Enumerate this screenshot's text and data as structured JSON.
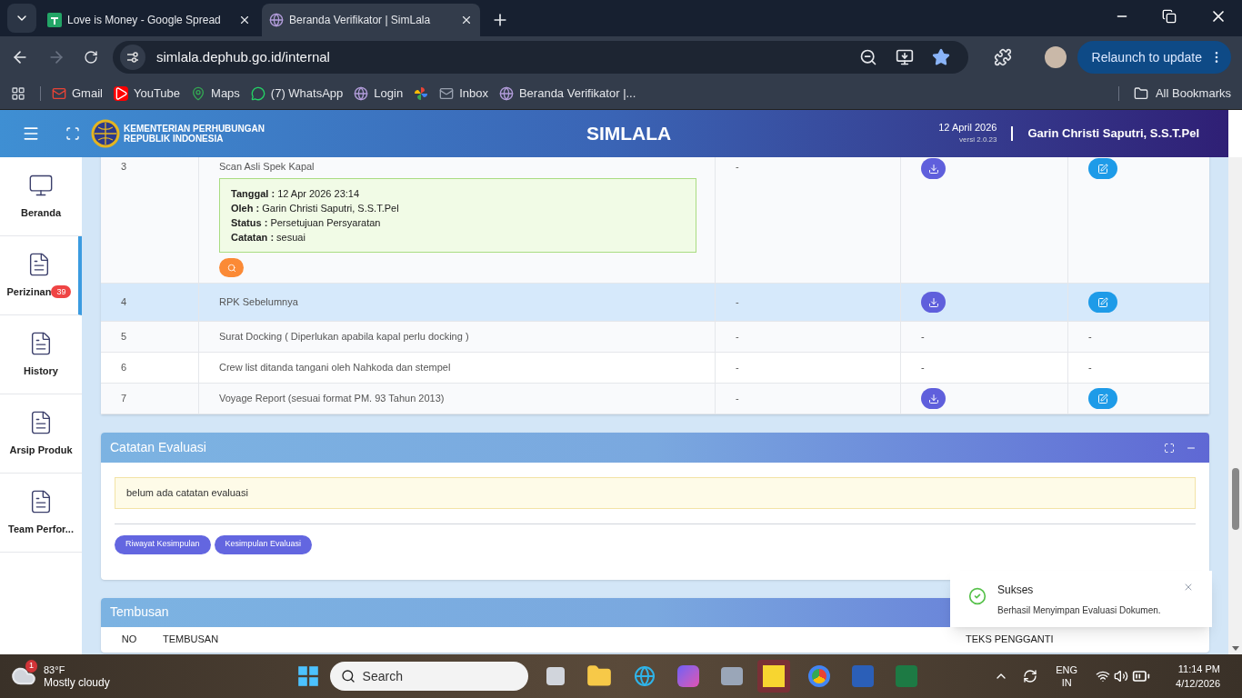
{
  "browser": {
    "tabs": [
      {
        "title": "Love is Money - Google Spread",
        "selected": false
      },
      {
        "title": "Beranda Verifikator | SimLala",
        "selected": true
      }
    ],
    "address": "simlala.dephub.go.id/internal",
    "relaunch_button": "Relaunch to update",
    "bookmarks": [
      "Gmail",
      "YouTube",
      "Maps",
      "(7) WhatsApp",
      "Login",
      "Inbox",
      "Beranda Verifikator |..."
    ],
    "all_bookmarks": "All Bookmarks"
  },
  "header": {
    "org_lines": [
      "KEMENTERIAN PERHUBUNGAN",
      "REPUBLIK INDONESIA"
    ],
    "title": "SIMLALA",
    "date": "12 April 2026",
    "version": "versi 2.0.23",
    "user": "Garin Christi Saputri, S.S.T.Pel"
  },
  "sidebar": {
    "items": [
      {
        "label": "Beranda",
        "selected": false
      },
      {
        "label": "Perizinan",
        "selected": true,
        "badge": "39"
      },
      {
        "label": "History",
        "selected": false
      },
      {
        "label": "Arsip Produk",
        "selected": false
      },
      {
        "label": "Team Perfor...",
        "selected": false
      }
    ]
  },
  "documents": {
    "rows": [
      {
        "no": "3",
        "name": "Scan Asli Spek Kapal",
        "highlighted": false,
        "note": [
          {
            "label": "Tanggal :",
            "value": "12 Apr 2026 23:14"
          },
          {
            "label": "Oleh :",
            "value": "Garin Christi Saputri, S.S.T.Pel"
          },
          {
            "label": "Status :",
            "value": "Persetujuan Persyaratan"
          },
          {
            "label": "Catatan :",
            "value": "sesuai"
          }
        ],
        "column_3": "-",
        "actions": [
          {
            "kind": "download"
          },
          {
            "kind": "edit"
          }
        ]
      },
      {
        "no": "4",
        "name": "RPK Sebelumnya",
        "highlighted": true,
        "column_3": "-",
        "actions": [
          {
            "kind": "download"
          },
          {
            "kind": "edit"
          }
        ]
      },
      {
        "no": "5",
        "name": "Surat Docking ( Diperlukan apabila kapal perlu docking )",
        "highlighted": false,
        "column_3": "-",
        "actions": [
          {
            "kind": "text",
            "text": "-"
          },
          {
            "kind": "text",
            "text": "-"
          }
        ]
      },
      {
        "no": "6",
        "name": "Crew list ditanda tangani oleh Nahkoda dan stempel",
        "highlighted": false,
        "column_3": "-",
        "actions": [
          {
            "kind": "text",
            "text": "-"
          },
          {
            "kind": "text",
            "text": "-"
          }
        ]
      },
      {
        "no": "7",
        "name": "Voyage Report (sesuai format PM. 93 Tahun 2013)",
        "highlighted": false,
        "column_3": "-",
        "actions": [
          {
            "kind": "download"
          },
          {
            "kind": "edit"
          }
        ]
      }
    ]
  },
  "evaluation": {
    "title": "Catatan Evaluasi",
    "note": "belum ada catatan evaluasi",
    "buttons": [
      "Riwayat Kesimpulan",
      "Kesimpulan Evaluasi"
    ]
  },
  "carbon_copy": {
    "title": "Tembusan",
    "columns": [
      "NO",
      "TEMBUSAN",
      "TEKS PENGGANTI"
    ]
  },
  "toast": {
    "title": "Sukses",
    "message": "Berhasil Menyimpan Evaluasi Dokumen."
  },
  "taskbar": {
    "temperature": "83°F",
    "weather_badge": "1",
    "weather": "Mostly cloudy",
    "search_placeholder": "Search",
    "language": [
      "ENG",
      "IN"
    ],
    "time": "11:14 PM",
    "date": "4/12/2026"
  }
}
